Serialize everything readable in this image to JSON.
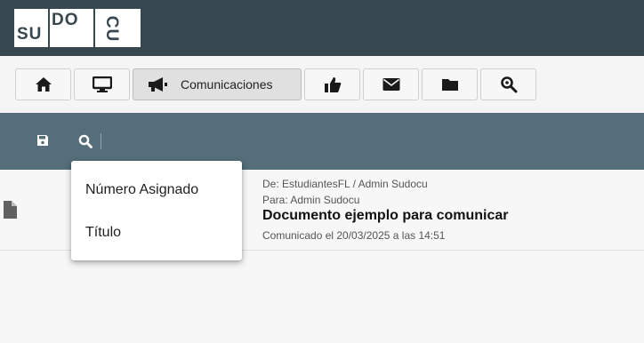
{
  "header": {
    "logo": {
      "part1": "SU",
      "part2": "DO",
      "part3": "CU"
    }
  },
  "toolbar": {
    "buttons": [
      {
        "icon": "home-icon"
      },
      {
        "icon": "monitor-icon"
      },
      {
        "icon": "megaphone-icon",
        "label": "Comunicaciones",
        "active": true
      },
      {
        "icon": "thumbs-up-icon"
      },
      {
        "icon": "envelope-icon"
      },
      {
        "icon": "folder-icon"
      },
      {
        "icon": "search-gear-icon"
      }
    ]
  },
  "actionbar": {
    "icons": [
      "save-icon",
      "search-icon"
    ]
  },
  "search_dropdown": {
    "options": [
      "Número Asignado",
      "Título"
    ]
  },
  "list": {
    "items": [
      {
        "icon": "document-icon",
        "from": "De: EstudiantesFL / Admin Sudocu",
        "to": "Para: Admin Sudocu",
        "title": "Documento ejemplo para comunicar",
        "date": "Comunicado el 20/03/2025 a las 14:51"
      }
    ]
  },
  "colors": {
    "header_bg": "#37474f",
    "actionbar_bg": "#546e7a",
    "toolbar_bg": "#f5f5f5",
    "content_bg": "#f7f7f7"
  }
}
